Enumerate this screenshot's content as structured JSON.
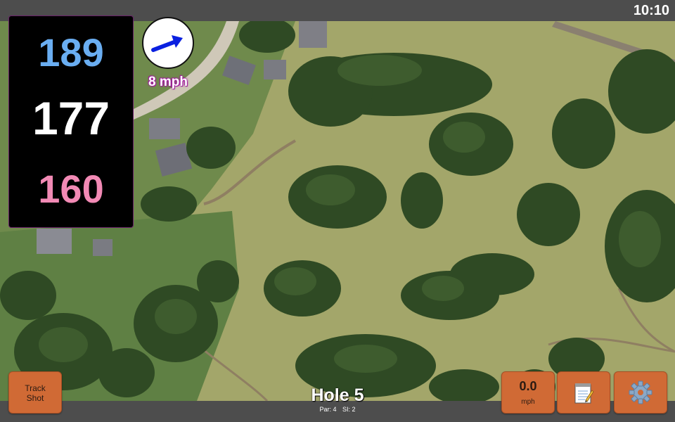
{
  "status_bar": {
    "time": "10:10"
  },
  "distances": {
    "back": "189",
    "middle": "177",
    "front": "160"
  },
  "wind": {
    "speed_label": "8 mph",
    "direction_icon": "arrow-icon"
  },
  "track_shot": {
    "line1": "Track",
    "line2": "Shot"
  },
  "speed": {
    "value": "0.0",
    "unit": "mph"
  },
  "notes": {
    "icon": "notepad-icon"
  },
  "settings": {
    "icon": "gear-icon"
  },
  "hole": {
    "title": "Hole 5",
    "par": "Par: 4",
    "si": "SI: 2"
  },
  "colors": {
    "back_distance": "#6aaef2",
    "middle_distance": "#ffffff",
    "front_distance": "#f28ab5",
    "button_orange": "#d06a35",
    "bar_gray": "#4d4d4d"
  }
}
